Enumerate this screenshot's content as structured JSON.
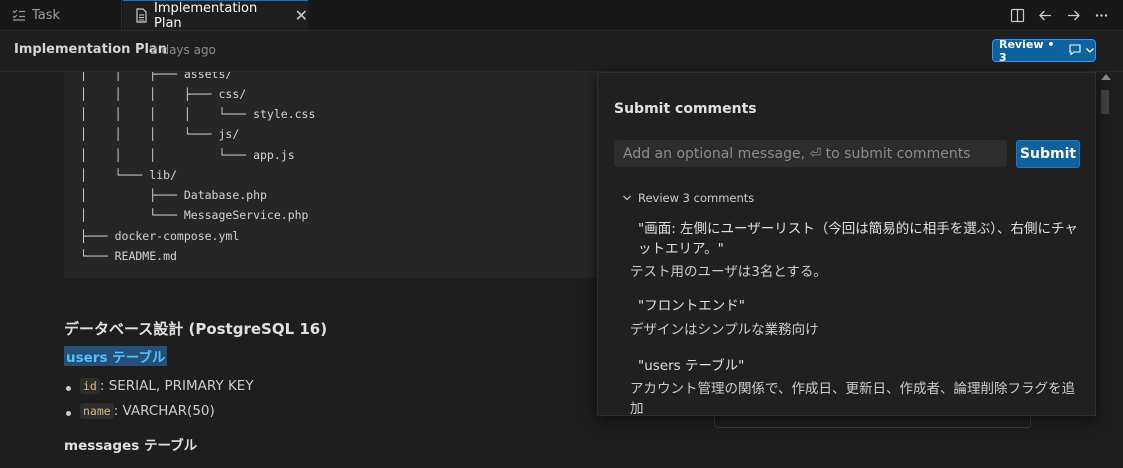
{
  "tabs": {
    "task_label": "Task",
    "plan_label": "Implementation Plan",
    "task_icon": "checklist-icon",
    "plan_icon": "file-icon"
  },
  "header": {
    "title": "Implementation Plan",
    "meta": "2 days ago",
    "review_label": "Review • 3"
  },
  "code_lines": [
    "│    │    ├─── assets/",
    "│    │    │    ├─── css/",
    "│    │    │    │    └─── style.css",
    "│    │    │    └─── js/",
    "│    │    │         └─── app.js",
    "│    └─── lib/",
    "│         ├─── Database.php",
    "│         └─── MessageService.php",
    "├─── docker-compose.yml",
    "└─── README.md"
  ],
  "doc": {
    "db_heading": "データベース設計 (PostgreSQL 16)",
    "users_heading": "users テーブル",
    "fields": [
      {
        "code": "id",
        "desc": ": SERIAL, PRIMARY KEY"
      },
      {
        "code": "name",
        "desc": ": VARCHAR(50)"
      }
    ],
    "messages_heading": "messages テーブル"
  },
  "panel": {
    "title": "Submit comments",
    "placeholder": "Add an optional message, ⏎ to submit comments",
    "submit_label": "Submit",
    "review_heading": "Review 3 comments",
    "comments": [
      {
        "quote": "\"画面: 左側にユーザーリスト（今回は簡易的に相手を選ぶ）、右側にチャットエリア。\"",
        "text": "テスト用のユーザは3名とする。"
      },
      {
        "quote": "\"フロントエンド\"",
        "text": "デザインはシンプルな業務向け"
      },
      {
        "quote": "\"users テーブル\"",
        "text": "アカウント管理の関係で、作成日、更新日、作成者、論理削除フラグを追加"
      }
    ]
  },
  "colors": {
    "accent": "#0e639c",
    "link": "#4fc1ff"
  }
}
